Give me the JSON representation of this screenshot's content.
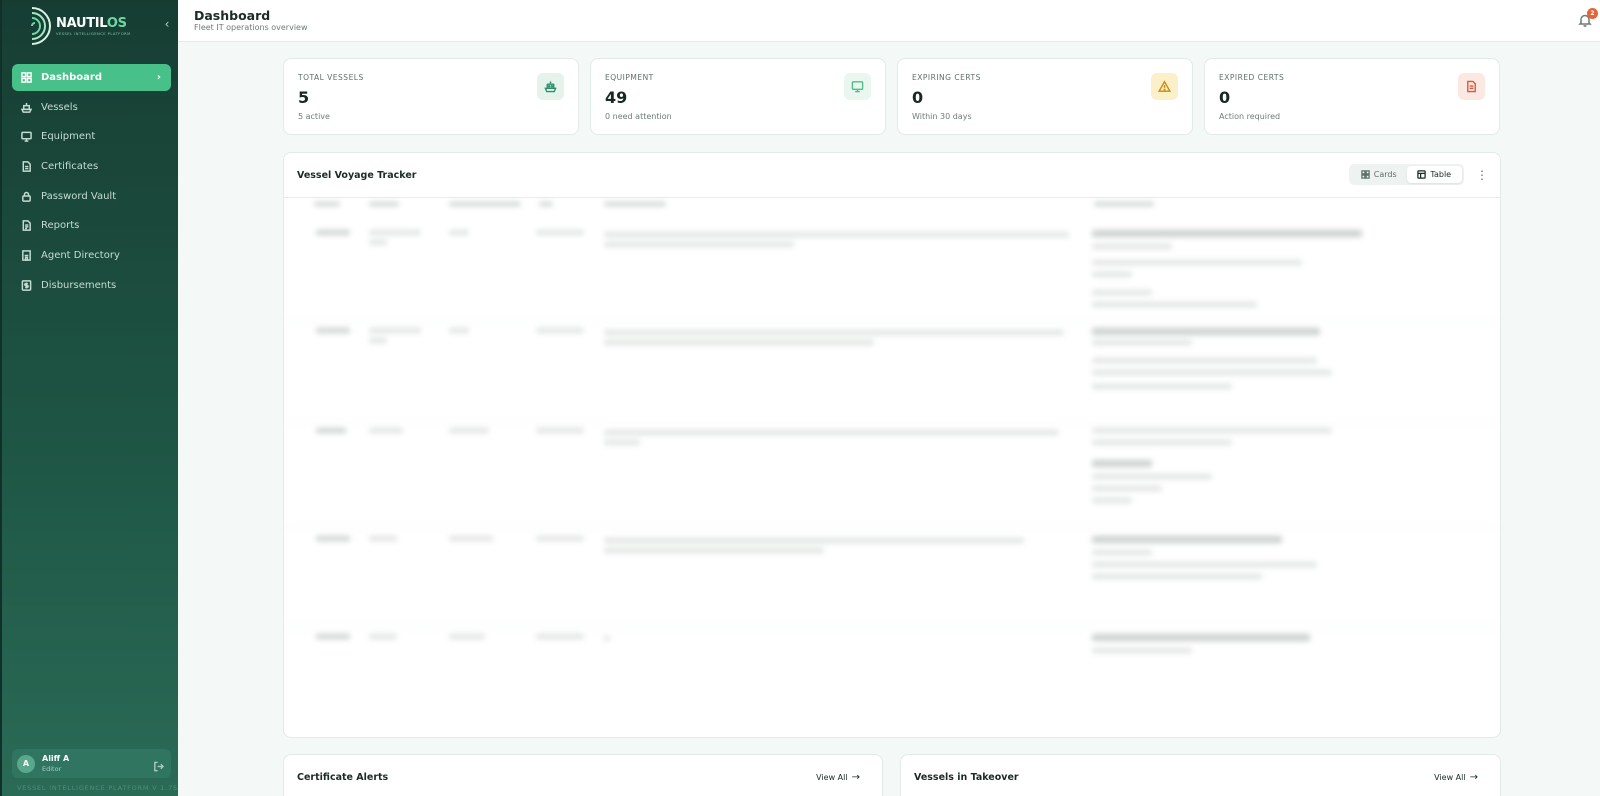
{
  "brand": {
    "name_main": "NAUTIL",
    "name_accent": "OS",
    "tagline": "VESSEL INTELLIGENCE PLATFORM"
  },
  "sidebar": {
    "collapse_icon": "chevron-left-icon",
    "items": [
      {
        "label": "Dashboard",
        "icon": "grid-icon",
        "active": true
      },
      {
        "label": "Vessels",
        "icon": "ship-icon"
      },
      {
        "label": "Equipment",
        "icon": "monitor-icon"
      },
      {
        "label": "Certificates",
        "icon": "file-icon"
      },
      {
        "label": "Password Vault",
        "icon": "lock-icon"
      },
      {
        "label": "Reports",
        "icon": "report-icon"
      },
      {
        "label": "Agent Directory",
        "icon": "building-icon"
      },
      {
        "label": "Disbursements",
        "icon": "dollar-icon"
      }
    ],
    "user": {
      "initial": "A",
      "name": "Aliff A",
      "role": "Editor"
    },
    "version": "VESSEL INTELLIGENCE PLATFORM V 1.75"
  },
  "header": {
    "title": "Dashboard",
    "subtitle": "Fleet IT operations overview",
    "notification_count": "2"
  },
  "stats": [
    {
      "label": "TOTAL VESSELS",
      "value": "5",
      "note": "5 active",
      "icon": "ship-icon",
      "color": "#2f8f6a",
      "bg": "#e5f3ec"
    },
    {
      "label": "EQUIPMENT",
      "value": "49",
      "note": "0 need attention",
      "icon": "monitor-icon",
      "color": "#4fbf86",
      "bg": "#eaf7f0"
    },
    {
      "label": "EXPIRING CERTS",
      "value": "0",
      "note": "Within 30 days",
      "icon": "warning-icon",
      "color": "#c98a12",
      "bg": "#fcf0c9"
    },
    {
      "label": "EXPIRED CERTS",
      "value": "0",
      "note": "Action required",
      "icon": "file-icon",
      "color": "#d8593a",
      "bg": "#fce8e2"
    }
  ],
  "tracker": {
    "title": "Vessel Voyage Tracker",
    "view_cards": "Cards",
    "view_table": "Table",
    "rows": [
      {},
      {},
      {},
      {},
      {}
    ]
  },
  "bottom": {
    "left": {
      "title": "Certificate Alerts",
      "link": "View All"
    },
    "right": {
      "title": "Vessels in Takeover",
      "link": "View All"
    }
  }
}
